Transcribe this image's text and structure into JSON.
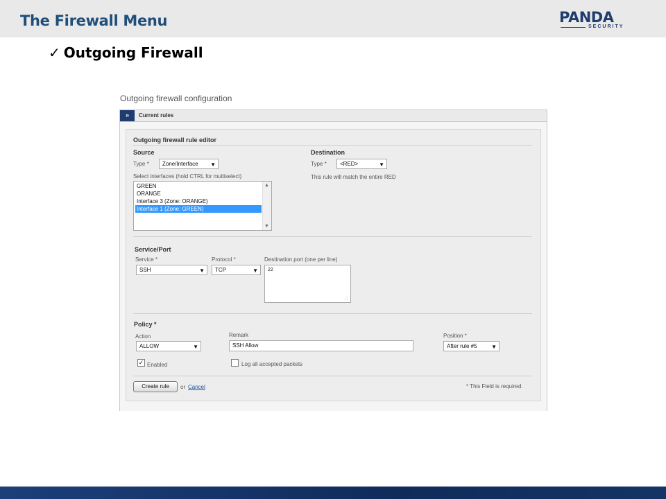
{
  "slide": {
    "title": "The Firewall Menu",
    "logo_main": "PANDA",
    "logo_sub": "SECURITY",
    "bullet_check": "✓",
    "bullet": "Outgoing Firewall"
  },
  "app": {
    "page_title": "Outgoing firewall configuration",
    "tab_arrow": "»",
    "tab_label": "Current rules",
    "editor_title": "Outgoing firewall rule editor",
    "source": {
      "heading": "Source",
      "type_label": "Type *",
      "type_value": "Zone/Interface",
      "interfaces_label": "Select interfaces (hold CTRL for multiselect)",
      "interfaces": [
        {
          "label": "GREEN",
          "selected": false
        },
        {
          "label": "ORANGE",
          "selected": false
        },
        {
          "label": "Interface 3 (Zone: ORANGE)",
          "selected": false
        },
        {
          "label": "Interface 1 (Zone: GREEN)",
          "selected": true
        }
      ]
    },
    "destination": {
      "heading": "Destination",
      "type_label": "Type *",
      "type_value": "<RED>",
      "note": "This rule will match the entire RED"
    },
    "service_port": {
      "heading": "Service/Port",
      "service_label": "Service *",
      "service_value": "SSH",
      "protocol_label": "Protocol *",
      "protocol_value": "TCP",
      "port_label": "Destination port (one per line)",
      "port_value": "22"
    },
    "policy": {
      "heading": "Policy *",
      "action_label": "Action",
      "action_value": "ALLOW",
      "remark_label": "Remark",
      "remark_value": "SSH Allow",
      "position_label": "Position *",
      "position_value": "After rule #5",
      "enabled_label": "Enabled",
      "enabled_checked": true,
      "log_label": "Log all accepted packets",
      "log_checked": false
    },
    "footer": {
      "create_button": "Create rule",
      "or_text": "or",
      "cancel_link": "Cancel",
      "required_note": "* This Field is required."
    }
  },
  "icons": {
    "dropdown_arrow": "▼",
    "scroll_up": "▲",
    "scroll_down": "▼",
    "check_mark": "✓",
    "resize_grip": ".::"
  },
  "colors": {
    "title_blue": "#1f4e79",
    "brand_navy": "#1f3c6e",
    "selection_blue": "#3399ff",
    "link_blue": "#1a4fa0"
  }
}
